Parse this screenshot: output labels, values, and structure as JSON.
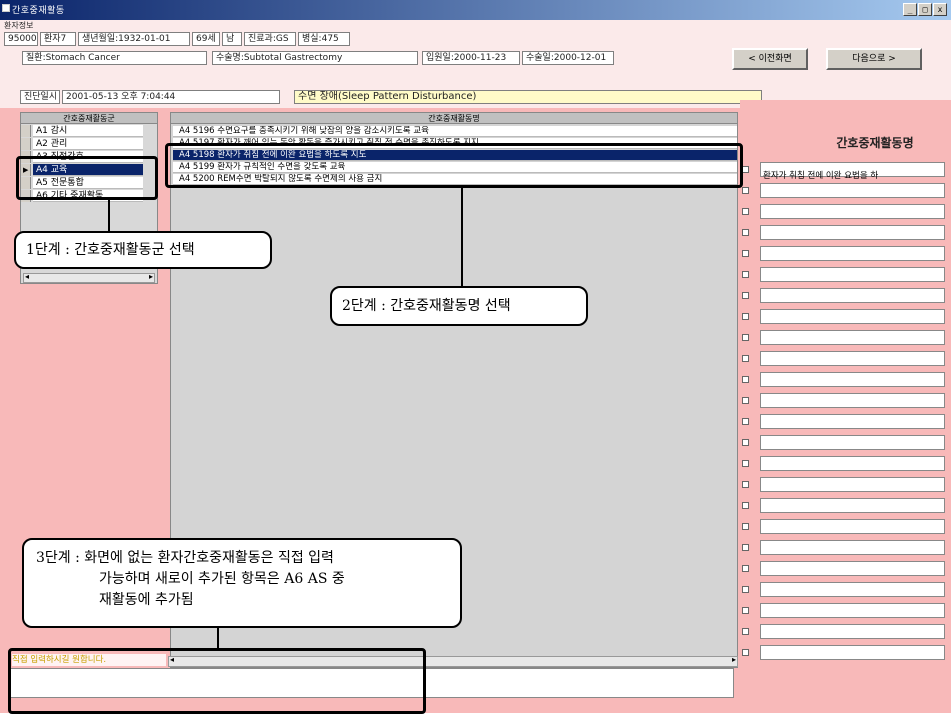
{
  "window": {
    "title": "간호중재활동",
    "controls": [
      "_",
      "□",
      "x"
    ]
  },
  "patient_label": "환자정보",
  "patient_fields": [
    "950007",
    "환자7",
    "생년월일:1932-01-01",
    "69세",
    "남",
    "진료과:GS",
    "병실:475"
  ],
  "diagnosis": {
    "label": "질환",
    "value": "Stomach Cancer",
    "surgery_label": "수술명",
    "surgery_value": "Subtotal Gastrectomy",
    "admit_label": "입원일",
    "admit_value": "2000-11-23",
    "op_label": "수술일",
    "op_value": "2000-12-01"
  },
  "nav": {
    "prev_label": "< 이전화면",
    "next_label": "다음으로 >"
  },
  "assessment": {
    "label": "진단일시",
    "datetime": "2001-05-13 오후 7:04:44",
    "nursing_dx": "수면 장애(Sleep Pattern Disturbance)"
  },
  "group_panel": {
    "header": "간호중재활동군",
    "items": [
      {
        "code": "A1",
        "label": "A1 감시"
      },
      {
        "code": "A2",
        "label": "A2 관리"
      },
      {
        "code": "A3",
        "label": "A3 직접간호"
      },
      {
        "code": "A4",
        "label": "A4 교육"
      },
      {
        "code": "A5",
        "label": "A5 전문통합"
      },
      {
        "code": "A6",
        "label": "A6 기타 중재활동"
      }
    ],
    "active_index": 3
  },
  "activity_panel": {
    "header": "간호중재활동명",
    "rows": [
      "A4 5196  수면요구를 충족시키기 위해 낮잠의 양을 감소시키도록 교육",
      "A4 5197  환자가 깨어 있는 동안 활동을 증가시키고 취침 전 수면을 촉진하도록 지지",
      "A4 5198  환자가 취침 전에 이완 요법을 하도록 지도",
      "A4 5199  환자가 규칙적인 수면을 갖도록 교육",
      "A4 5200  REM수면 박탈되지 않도록 수면제의 사용 금지"
    ],
    "active_index": 2
  },
  "right_panel": {
    "title": "간호중재활동명",
    "first_line": "환자가 취침 전에 이완 요법을 하",
    "line_count": 24
  },
  "bottom": {
    "label": "직접 입력하시길 원합니다.",
    "input_value": ""
  },
  "callouts": {
    "step1": "1단계 : 간호중재활동군 선택",
    "step2": "2단계 : 간호중재활동명 선택",
    "step3_line1": "3단계 : 화면에 없는 환자간호중재활동은 직접 입력",
    "step3_line2": "가능하며 새로이 추가된 항목은 A6 AS 중",
    "step3_line3": "재활동에 추가됨"
  }
}
